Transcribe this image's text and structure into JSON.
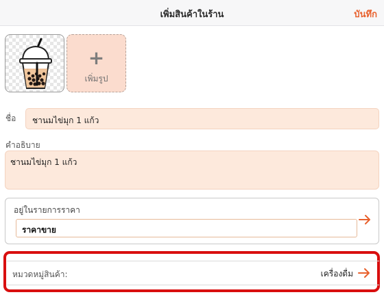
{
  "header": {
    "title": "เพิ่มสินค้าในร้าน",
    "save_label": "บันทึก"
  },
  "photos": {
    "product_image_name": "bubble-tea-icon",
    "add_photo_label": "เพิ่มรูป"
  },
  "form": {
    "name_label": "ชื่อ",
    "name_value": "ชานมไข่มุก 1 แก้ว",
    "description_label": "คำอธิบาย",
    "description_value": "ชานมไข่มุก 1 แก้ว",
    "price_list_label": "อยู่ในรายการราคา",
    "price_value": "ราคาขาย",
    "category_label": "หมวดหมู่สินค้า:",
    "category_value": "เครื่องดื่ม"
  },
  "colors": {
    "accent": "#e8602c",
    "input_fill": "#fde9dc",
    "highlight": "#d90f0f"
  }
}
